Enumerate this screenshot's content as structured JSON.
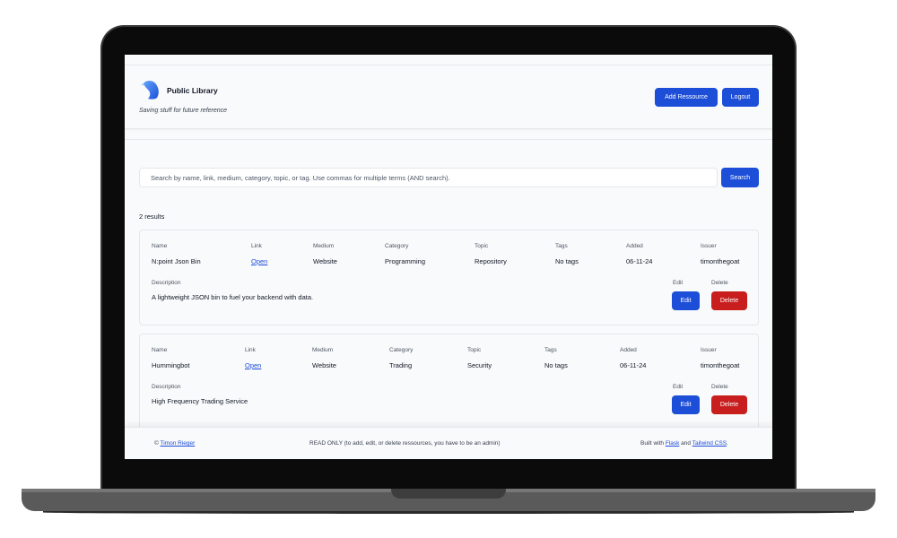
{
  "app": {
    "title": "Public Library",
    "tagline": "Saving stuff for future reference",
    "logo": "bird-logo-icon"
  },
  "header": {
    "add_label": "Add Ressource",
    "logout_label": "Logout"
  },
  "search": {
    "placeholder": "Search by name, link, medium, category, topic, or tag. Use commas for multiple terms (AND search).",
    "button_label": "Search"
  },
  "results": {
    "count_text": "2 results",
    "labels": {
      "name": "Name",
      "link": "Link",
      "medium": "Medium",
      "category": "Category",
      "topic": "Topic",
      "tags": "Tags",
      "added": "Added",
      "issuer": "Issuer",
      "description": "Description",
      "edit": "Edit",
      "delete": "Delete"
    },
    "items": [
      {
        "name": "N:point Json Bin",
        "link_text": "Open",
        "medium": "Website",
        "category": "Programming",
        "topic": "Repository",
        "tags": "No tags",
        "added": "06-11-24",
        "issuer": "timonthegoat",
        "description": "A lightweight JSON bin to fuel your backend with data.",
        "edit_label": "Edit",
        "delete_label": "Delete"
      },
      {
        "name": "Hummingbot",
        "link_text": "Open",
        "medium": "Website",
        "category": "Trading",
        "topic": "Security",
        "tags": "No tags",
        "added": "06-11-24",
        "issuer": "timonthegoat",
        "description": "High Frequency Trading Service",
        "edit_label": "Edit",
        "delete_label": "Delete"
      }
    ]
  },
  "footer": {
    "copyright_symbol": "©",
    "author": "Timon Rieger",
    "notice": "READ ONLY (to add, edit, or delete ressources, you have to be an admin)",
    "built_with": "Built with",
    "flask": "Flask",
    "and": "and",
    "tailwind": "Tailwind CSS",
    "period": "."
  },
  "colors": {
    "primary": "#1d4ed8",
    "danger": "#c81e1e",
    "background": "#f9fafb",
    "border": "#e5e7eb"
  }
}
